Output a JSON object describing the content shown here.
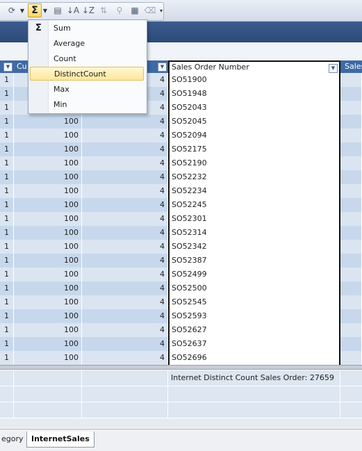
{
  "toolbar": {
    "icons": [
      "refresh-icon",
      "sigma-icon",
      "table-icon",
      "sort-ascending-icon",
      "sort-descending-icon",
      "clear-sort-icon",
      "filter-icon",
      "grid-icon",
      "clear-filter-icon"
    ]
  },
  "aggregate_menu": {
    "items": [
      {
        "label": "Sum",
        "icon": "Σ",
        "highlighted": false
      },
      {
        "label": "Average",
        "highlighted": false
      },
      {
        "label": "Count",
        "highlighted": false
      },
      {
        "label": "DistinctCount",
        "highlighted": true
      },
      {
        "label": "Max",
        "highlighted": false
      },
      {
        "label": "Min",
        "highlighted": false
      }
    ]
  },
  "grid": {
    "headers": [
      {
        "label": ""
      },
      {
        "label": "Cu"
      },
      {
        "label": ""
      },
      {
        "label": "Sales Order Number"
      },
      {
        "label": "Sales"
      }
    ],
    "rows": [
      {
        "c1": "1",
        "c2": "",
        "c3": "4",
        "c4": "SO51900"
      },
      {
        "c1": "1",
        "c2": "",
        "c3": "4",
        "c4": "SO51948"
      },
      {
        "c1": "1",
        "c2": "",
        "c3": "4",
        "c4": "SO52043"
      },
      {
        "c1": "1",
        "c2": "100",
        "c3": "4",
        "c4": "SO52045"
      },
      {
        "c1": "1",
        "c2": "100",
        "c3": "4",
        "c4": "SO52094"
      },
      {
        "c1": "1",
        "c2": "100",
        "c3": "4",
        "c4": "SO52175"
      },
      {
        "c1": "1",
        "c2": "100",
        "c3": "4",
        "c4": "SO52190"
      },
      {
        "c1": "1",
        "c2": "100",
        "c3": "4",
        "c4": "SO52232"
      },
      {
        "c1": "1",
        "c2": "100",
        "c3": "4",
        "c4": "SO52234"
      },
      {
        "c1": "1",
        "c2": "100",
        "c3": "4",
        "c4": "SO52245"
      },
      {
        "c1": "1",
        "c2": "100",
        "c3": "4",
        "c4": "SO52301"
      },
      {
        "c1": "1",
        "c2": "100",
        "c3": "4",
        "c4": "SO52314"
      },
      {
        "c1": "1",
        "c2": "100",
        "c3": "4",
        "c4": "SO52342"
      },
      {
        "c1": "1",
        "c2": "100",
        "c3": "4",
        "c4": "SO52387"
      },
      {
        "c1": "1",
        "c2": "100",
        "c3": "4",
        "c4": "SO52499"
      },
      {
        "c1": "1",
        "c2": "100",
        "c3": "4",
        "c4": "SO52500"
      },
      {
        "c1": "1",
        "c2": "100",
        "c3": "4",
        "c4": "SO52545"
      },
      {
        "c1": "1",
        "c2": "100",
        "c3": "4",
        "c4": "SO52593"
      },
      {
        "c1": "1",
        "c2": "100",
        "c3": "4",
        "c4": "SO52627"
      },
      {
        "c1": "1",
        "c2": "100",
        "c3": "4",
        "c4": "SO52637"
      },
      {
        "c1": "1",
        "c2": "100",
        "c3": "4",
        "c4": "SO52696"
      }
    ]
  },
  "measure_grid": {
    "text": "Internet Distinct Count Sales Order: 27659"
  },
  "tabs": {
    "inactive": "egory",
    "active": "InternetSales"
  }
}
